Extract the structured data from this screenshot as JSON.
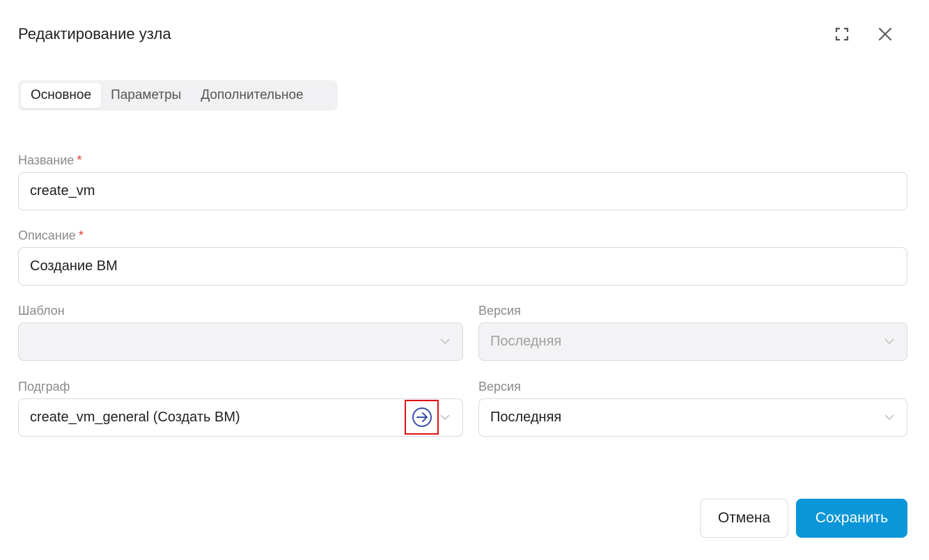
{
  "dialog": {
    "title": "Редактирование узла"
  },
  "tabs": [
    {
      "label": "Основное",
      "active": true
    },
    {
      "label": "Параметры",
      "active": false
    },
    {
      "label": "Дополнительное",
      "active": false
    }
  ],
  "form": {
    "name": {
      "label": "Название",
      "required_mark": "*",
      "value": "create_vm"
    },
    "description": {
      "label": "Описание",
      "required_mark": "*",
      "value": "Создание ВМ"
    },
    "template": {
      "label": "Шаблон",
      "value": ""
    },
    "template_version": {
      "label": "Версия",
      "value": "Последняя"
    },
    "subgraph": {
      "label": "Подграф",
      "value": "create_vm_general (Создать ВМ)"
    },
    "subgraph_version": {
      "label": "Версия",
      "value": "Последняя"
    }
  },
  "actions": {
    "cancel_label": "Отмена",
    "save_label": "Сохранить"
  },
  "icons": {
    "expand": "expand-icon",
    "close": "close-icon",
    "chevron": "chevron-down-icon",
    "navigate": "arrow-right-circle-icon"
  },
  "colors": {
    "primary": "#0a96d9",
    "required": "#e53935",
    "navigate_icon": "#3b4fa8",
    "highlight_border": "#e01010"
  }
}
